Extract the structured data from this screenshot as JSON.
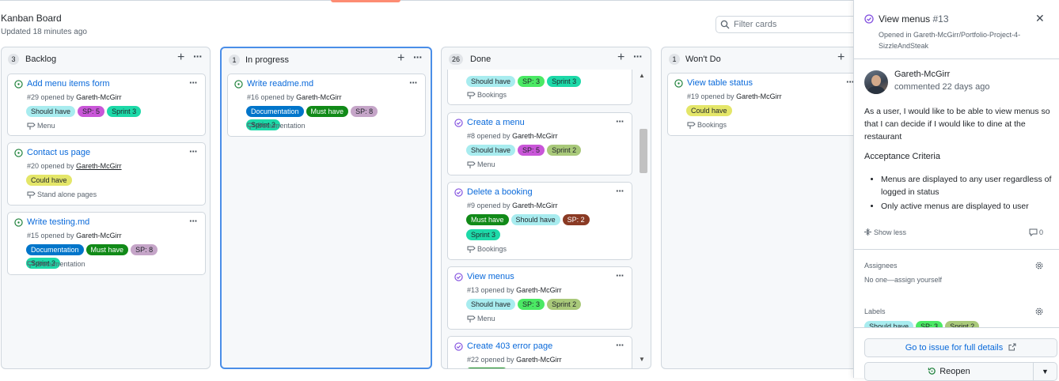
{
  "board": {
    "title": "Kanban Board",
    "updated": "Updated 18 minutes ago",
    "filter_placeholder": "Filter cards"
  },
  "columns": [
    {
      "name": "Backlog",
      "count": "3",
      "cards": [
        {
          "title": "Add menu items form",
          "meta": "#29 opened by ",
          "user": "Gareth-McGirr",
          "labels": [
            "Should have",
            "SP: 5",
            "Sprint 3"
          ],
          "milestone": "Menu"
        },
        {
          "title": "Contact us page",
          "meta": "#20 opened by ",
          "user": "Gareth-McGirr",
          "labels": [
            "Could have"
          ],
          "milestone": "Stand alone pages"
        },
        {
          "title": "Write testing.md",
          "meta": "#15 opened by ",
          "user": "Gareth-McGirr",
          "labels": [
            "Documentation",
            "Must have",
            "SP: 8",
            "Sprint 3"
          ],
          "milestone": "Documentation"
        }
      ]
    },
    {
      "name": "In progress",
      "count": "1",
      "cards": [
        {
          "title": "Write readme.md",
          "meta": "#16 opened by ",
          "user": "Gareth-McGirr",
          "labels": [
            "Documentation",
            "Must have",
            "SP: 8",
            "Sprint 3"
          ],
          "milestone": "Documentation"
        }
      ]
    },
    {
      "name": "Done",
      "count": "26",
      "cards": [
        {
          "title": "",
          "meta": "",
          "user": "",
          "labels": [
            "Should have",
            "SP: 3",
            "Sprint 3"
          ],
          "milestone": "Bookings"
        },
        {
          "title": "Create a menu",
          "meta": "#8 opened by ",
          "user": "Gareth-McGirr",
          "labels": [
            "Should have",
            "SP: 5",
            "Sprint 2"
          ],
          "milestone": "Menu"
        },
        {
          "title": "Delete a booking",
          "meta": "#9 opened by ",
          "user": "Gareth-McGirr",
          "labels": [
            "Must have",
            "Should have",
            "SP: 2",
            "Sprint 3"
          ],
          "milestone": "Bookings"
        },
        {
          "title": "View menus",
          "meta": "#13 opened by ",
          "user": "Gareth-McGirr",
          "labels": [
            "Should have",
            "SP: 3",
            "Sprint 2"
          ],
          "milestone": "Menu"
        },
        {
          "title": "Create 403 error page",
          "meta": "#22 opened by ",
          "user": "Gareth-McGirr",
          "labels": [],
          "milestone": ""
        }
      ]
    },
    {
      "name": "Won't Do",
      "count": "1",
      "cards": [
        {
          "title": "View table status",
          "meta": "#19 opened by ",
          "user": "Gareth-McGirr",
          "labels": [
            "Could have"
          ],
          "milestone": "Bookings"
        }
      ]
    }
  ],
  "panel": {
    "title": "View menus",
    "number": "#13",
    "opened_in": "Opened in Gareth-McGirr/Portfolio-Project-4-SizzleAndSteak",
    "author": "Gareth-McGirr",
    "commented": "commented 22 days ago",
    "body": "As a user, I would like to be able to view menus so that I can decide if I would like to dine at the restaurant",
    "acceptance_title": "Acceptance Criteria",
    "acceptance": [
      "Menus are displayed to any user regardless of logged in status",
      "Only active menus are displayed to user"
    ],
    "show_less": "Show less",
    "comment_count": "0",
    "assignees_title": "Assignees",
    "assignees_text": "No one—assign yourself",
    "labels_title": "Labels",
    "labels": [
      "Should have",
      "SP: 3",
      "Sprint 2"
    ],
    "go_to_issue": "Go to issue for full details",
    "reopen": "Reopen"
  },
  "colors": {
    "link": "#0969da",
    "done_purple": "#8250df",
    "open_green": "#1a7f37",
    "active_border": "#4a8ee8"
  }
}
